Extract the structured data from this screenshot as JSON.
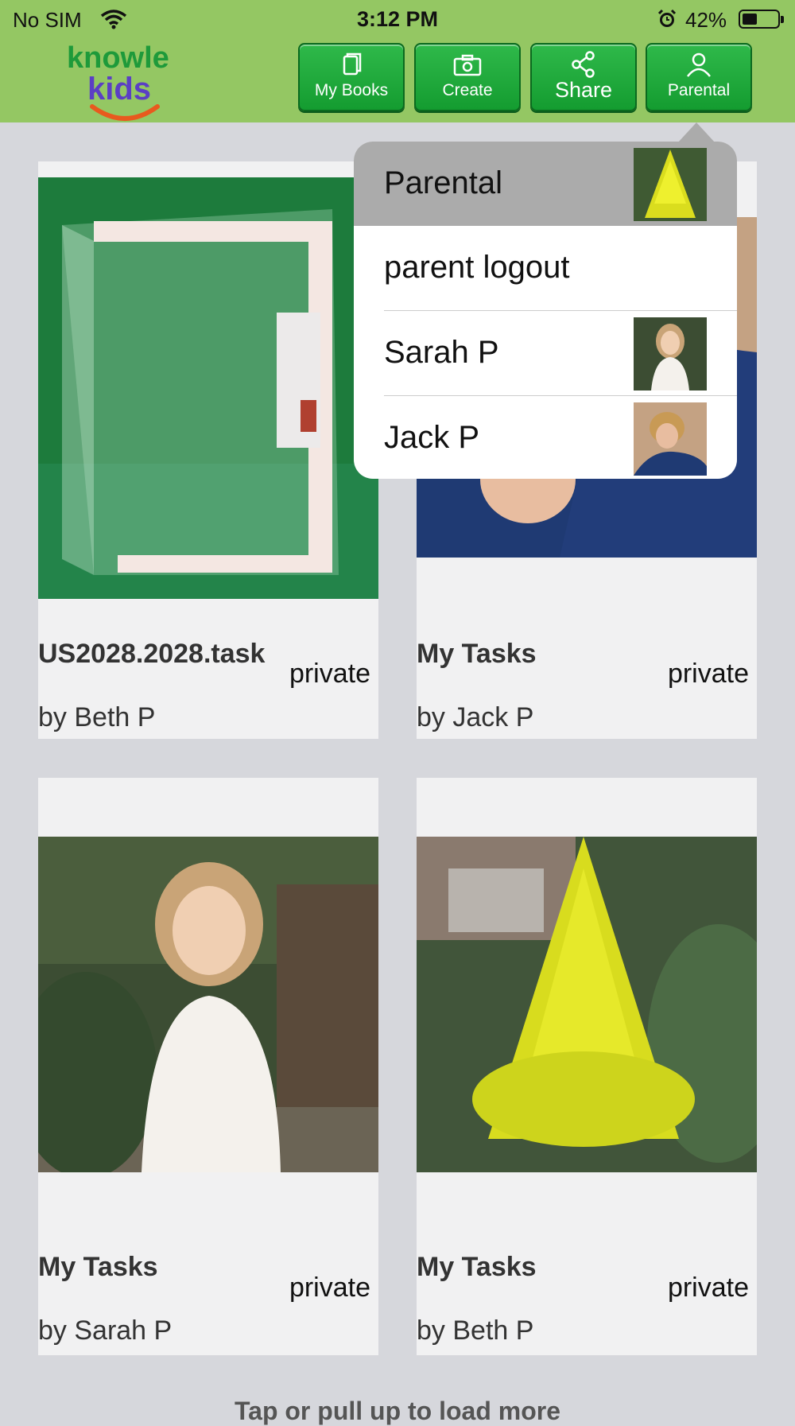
{
  "status_bar": {
    "carrier": "No SIM",
    "time": "3:12 PM",
    "battery": "42%",
    "battery_level": 0.42,
    "wifi_icon": "wifi-icon",
    "alarm_icon": "alarm-icon"
  },
  "app": {
    "logo_line1": "knowle",
    "logo_line2": "kids",
    "header_color": "#94c763",
    "button_color": "#1eaa3c"
  },
  "nav": {
    "my_books": "My Books",
    "create": "Create",
    "share": "Share",
    "parental": "Parental"
  },
  "cards": [
    {
      "title": "US2028.2028.task",
      "visibility": "private",
      "author": "by Beth P",
      "image": "acrylic-box-photo"
    },
    {
      "title": "My Tasks",
      "visibility": "private",
      "author": "by Jack P",
      "image": "boy-portrait-photo"
    },
    {
      "title": "My Tasks",
      "visibility": "private",
      "author": "by Sarah P",
      "image": "girl-portrait-photo"
    },
    {
      "title": "My Tasks",
      "visibility": "private",
      "author": "by Beth P",
      "image": "yellow-flower-photo"
    }
  ],
  "dropdown": {
    "items": [
      {
        "label": "Parental",
        "thumb": "yellow-flower-photo"
      },
      {
        "label": "parent logout"
      },
      {
        "label": "Sarah P",
        "thumb": "girl-portrait-photo"
      },
      {
        "label": "Jack P",
        "thumb": "boy-portrait-photo"
      }
    ]
  },
  "footer": {
    "load_more": "Tap or pull up to load more"
  }
}
